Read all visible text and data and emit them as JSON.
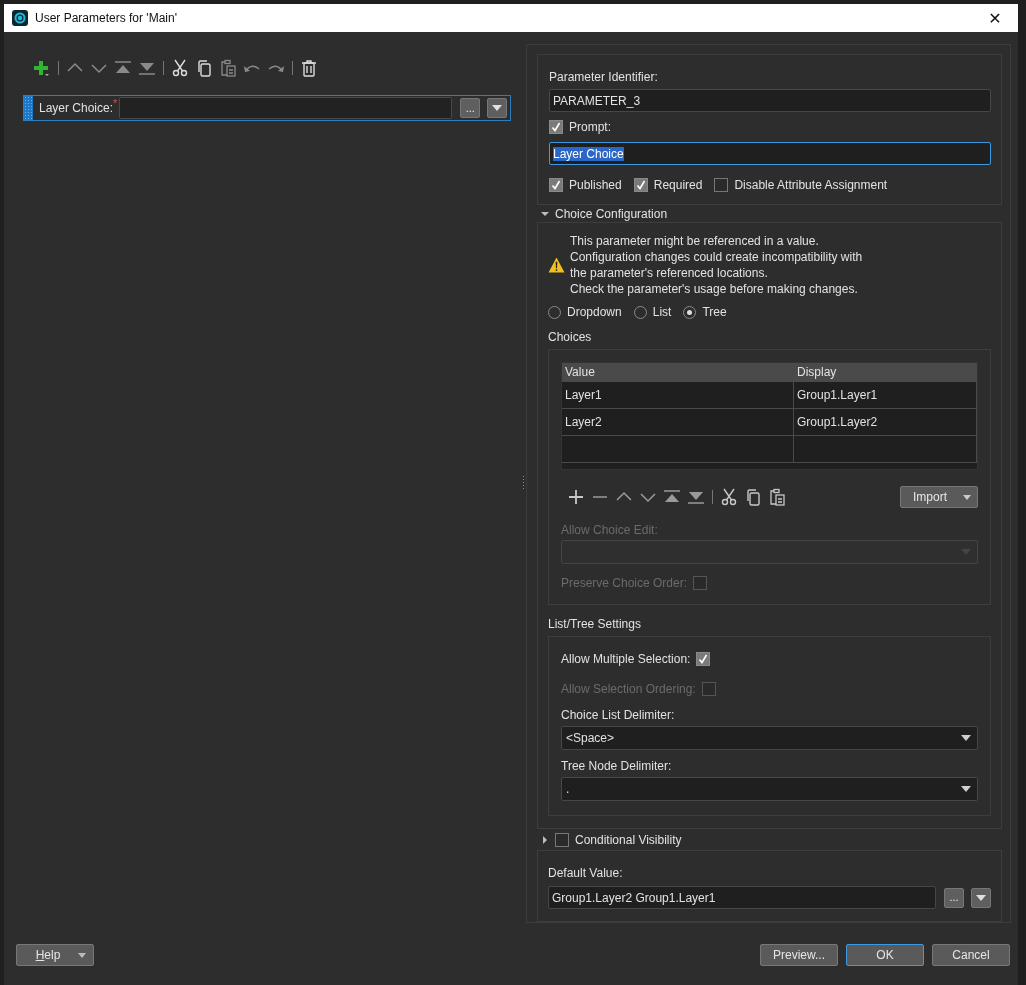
{
  "window": {
    "title": "User Parameters for 'Main'",
    "close": "✕"
  },
  "toolbar": [
    {
      "kind": "add-menu",
      "disabled": false
    },
    {
      "kind": "separator"
    },
    {
      "kind": "up",
      "disabled": true
    },
    {
      "kind": "down",
      "disabled": true
    },
    {
      "kind": "top",
      "disabled": true
    },
    {
      "kind": "bottom",
      "disabled": true
    },
    {
      "kind": "separator"
    },
    {
      "kind": "cut",
      "disabled": false
    },
    {
      "kind": "copy",
      "disabled": false
    },
    {
      "kind": "paste",
      "disabled": true
    },
    {
      "kind": "undo",
      "disabled": true
    },
    {
      "kind": "redo",
      "disabled": true
    },
    {
      "kind": "separator"
    },
    {
      "kind": "delete",
      "disabled": false
    }
  ],
  "parameters": [
    {
      "label": "Layer Choice:",
      "required_mark": "*",
      "selected": true,
      "browse_button": "..."
    }
  ],
  "properties": {
    "identifier_label": "Parameter Identifier:",
    "identifier": "PARAMETER_3",
    "prompt": {
      "label": "Prompt:",
      "checked": true
    },
    "prompt_value": "Layer Choice",
    "prompt_value_highlighted": true,
    "flags": [
      {
        "label": "Published",
        "checked": true
      },
      {
        "label": "Required",
        "checked": true
      },
      {
        "label": "Disable Attribute Assignment",
        "checked": false
      }
    ]
  },
  "choice_configuration": {
    "title": "Choice Configuration",
    "expanded": true,
    "warning": [
      "This parameter might be referenced in a value.",
      "Configuration changes could create incompatibility with",
      "the parameter's referenced locations.",
      "Check the parameter's usage before making changes."
    ],
    "modes": [
      {
        "label": "Dropdown",
        "selected": false
      },
      {
        "label": "List",
        "selected": false
      },
      {
        "label": "Tree",
        "selected": true
      }
    ],
    "choices_label": "Choices",
    "table": {
      "columns": [
        "Value",
        "Display"
      ],
      "rows": [
        [
          "Layer1",
          "Group1.Layer1"
        ],
        [
          "Layer2",
          "Group1.Layer2"
        ]
      ]
    },
    "toolbar": [
      {
        "kind": "add",
        "disabled": false
      },
      {
        "kind": "remove",
        "disabled": true
      },
      {
        "kind": "up",
        "disabled": true
      },
      {
        "kind": "down",
        "disabled": true
      },
      {
        "kind": "top",
        "disabled": true
      },
      {
        "kind": "bottom",
        "disabled": true
      },
      {
        "kind": "separator"
      },
      {
        "kind": "cut",
        "disabled": false
      },
      {
        "kind": "copy",
        "disabled": false
      },
      {
        "kind": "paste",
        "disabled": false
      }
    ],
    "import_button": "Import",
    "allow_choice_edit": {
      "label": "Allow Choice Edit:",
      "disabled": true
    },
    "preserve_order": {
      "label": "Preserve Choice Order:",
      "checked": false,
      "disabled": true
    }
  },
  "list_tree_settings": {
    "title": "List/Tree Settings",
    "allow_multiple": {
      "label": "Allow Multiple Selection:",
      "checked": true
    },
    "allow_ordering": {
      "label": "Allow Selection Ordering:",
      "checked": false,
      "disabled": true
    },
    "choice_list_delimiter": {
      "label": "Choice List Delimiter:",
      "value": "<Space>"
    },
    "tree_node_delimiter": {
      "label": "Tree Node Delimiter:",
      "value": "."
    }
  },
  "conditional_visibility": {
    "label": "Conditional Visibility",
    "checked": false,
    "expanded": false
  },
  "default_value": {
    "label": "Default Value:",
    "value": "Group1.Layer2 Group1.Layer1",
    "browse_button": "..."
  },
  "buttons": {
    "help": "Help",
    "preview": "Preview...",
    "ok": "OK",
    "cancel": "Cancel"
  }
}
